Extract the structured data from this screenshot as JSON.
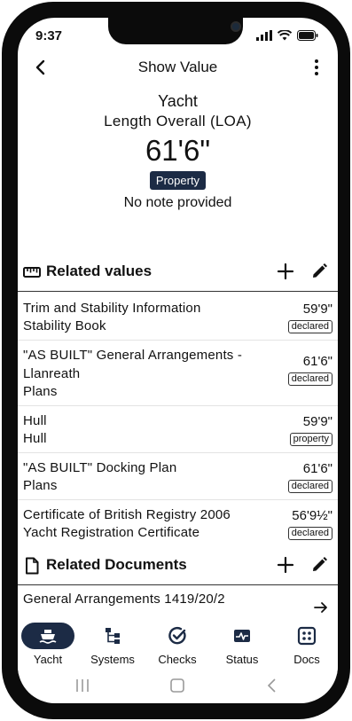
{
  "status": {
    "time": "9:37"
  },
  "header": {
    "title": "Show Value"
  },
  "hero": {
    "asset": "Yacht",
    "label": "Length Overall (LOA)",
    "value": "61'6\"",
    "badge": "Property",
    "note": "No note provided"
  },
  "related_values": {
    "title": "Related values",
    "items": [
      {
        "title": "Trim and Stability Information",
        "subtitle": "Stability Book",
        "value": "59'9\"",
        "tag": "declared"
      },
      {
        "title": "\"AS BUILT\" General Arrangements - Llanreath",
        "subtitle": "Plans",
        "value": "61'6\"",
        "tag": "declared"
      },
      {
        "title": "Hull",
        "subtitle": "Hull",
        "value": "59'9\"",
        "tag": "property"
      },
      {
        "title": "\"AS BUILT\" Docking Plan",
        "subtitle": "Plans",
        "value": "61'6\"",
        "tag": "declared"
      },
      {
        "title": "Certificate of British Registry 2006",
        "subtitle": "Yacht Registration Certificate",
        "value": "56'9½\"",
        "tag": "declared"
      }
    ]
  },
  "related_documents": {
    "title": "Related Documents",
    "items": [
      {
        "title": "General Arrangements 1419/20/2"
      }
    ]
  },
  "tabs": [
    {
      "label": "Yacht",
      "icon": "ship-icon",
      "active": true
    },
    {
      "label": "Systems",
      "icon": "systems-icon",
      "active": false
    },
    {
      "label": "Checks",
      "icon": "check-circle-icon",
      "active": false
    },
    {
      "label": "Status",
      "icon": "status-icon",
      "active": false
    },
    {
      "label": "Docs",
      "icon": "docs-icon",
      "active": false
    }
  ],
  "colors": {
    "accent": "#1c2b45",
    "text": "#111111",
    "divider": "#333333"
  }
}
